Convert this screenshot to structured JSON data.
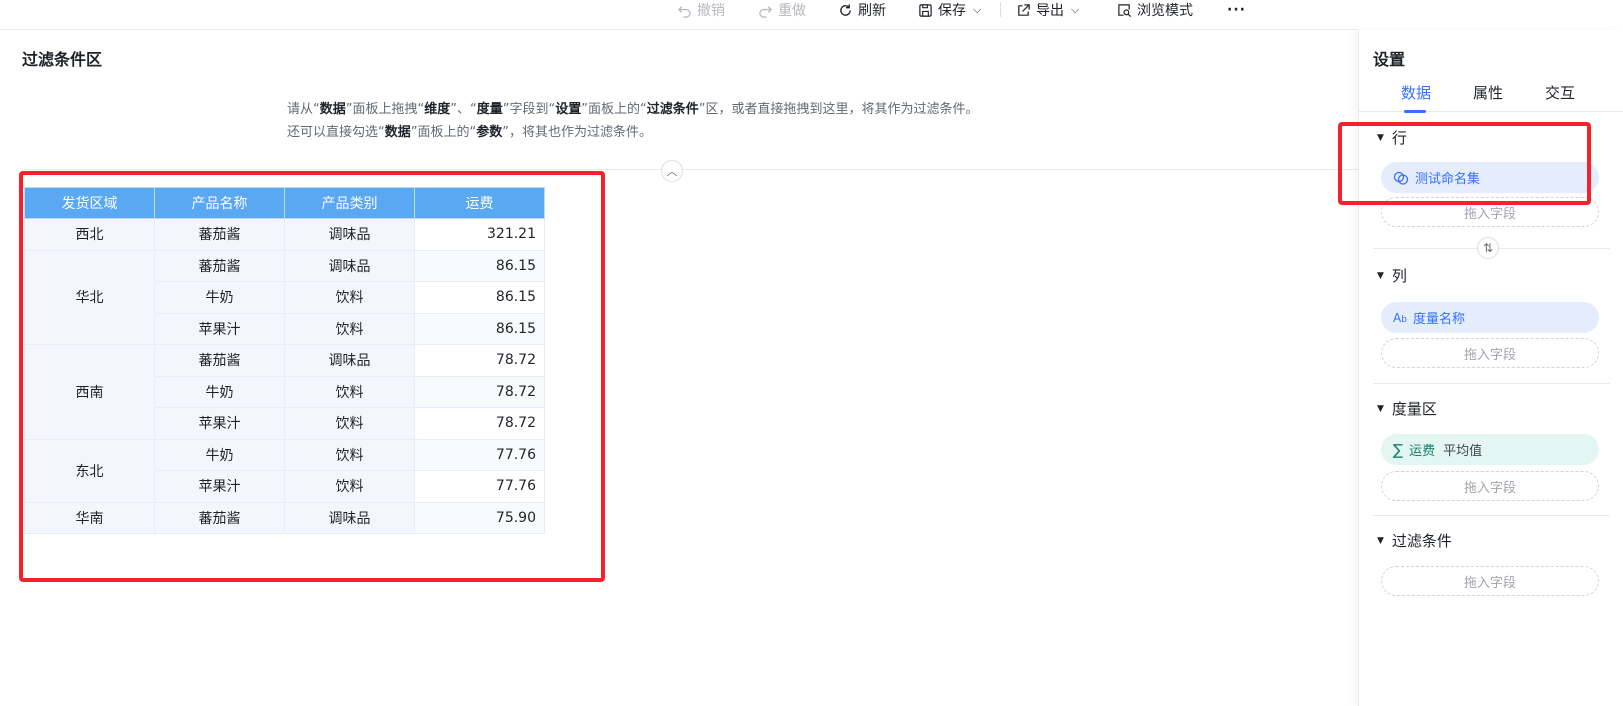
{
  "toolbar": {
    "undo": "撤销",
    "redo": "重做",
    "refresh": "刷新",
    "save": "保存",
    "export": "导出",
    "browse_mode": "浏览模式",
    "more": "···"
  },
  "filter_area": {
    "title": "过滤条件区",
    "hint1": {
      "p1": "请从“",
      "b1": "数据",
      "p2": "”面板上拖拽“",
      "b2": "维度",
      "p3": "”、“",
      "b3": "度量",
      "p4": "”字段到“",
      "b4": "设置",
      "p5": "”面板上的“",
      "b5": "过滤条件",
      "p6": "”区，或者直接拖拽到这里，将其作为过滤条件。"
    },
    "hint2": {
      "p1": "还可以直接勾选“",
      "b1": "数据",
      "p2": "”面板上的“",
      "b2": "参数",
      "p3": "”，将其也作为过滤条件。"
    },
    "collapse_icon": "chevron-up-icon"
  },
  "table": {
    "headers": [
      "发货区域",
      "产品名称",
      "产品类别",
      "运费"
    ],
    "groups": [
      {
        "region": "西北",
        "rows": [
          [
            "蕃茄酱",
            "调味品",
            "321.21"
          ]
        ]
      },
      {
        "region": "华北",
        "rows": [
          [
            "蕃茄酱",
            "调味品",
            "86.15"
          ],
          [
            "牛奶",
            "饮料",
            "86.15"
          ],
          [
            "苹果汁",
            "饮料",
            "86.15"
          ]
        ]
      },
      {
        "region": "西南",
        "rows": [
          [
            "蕃茄酱",
            "调味品",
            "78.72"
          ],
          [
            "牛奶",
            "饮料",
            "78.72"
          ],
          [
            "苹果汁",
            "饮料",
            "78.72"
          ]
        ]
      },
      {
        "region": "东北",
        "rows": [
          [
            "牛奶",
            "饮料",
            "77.76"
          ],
          [
            "苹果汁",
            "饮料",
            "77.76"
          ]
        ]
      },
      {
        "region": "华南",
        "rows": [
          [
            "蕃茄酱",
            "调味品",
            "75.90"
          ]
        ]
      }
    ]
  },
  "panel": {
    "title": "设置",
    "tabs": [
      "数据",
      "属性",
      "交互"
    ],
    "active_tab": "数据",
    "sections": {
      "row": {
        "label": "行",
        "field": "测试命名集",
        "drop": "拖入字段"
      },
      "column": {
        "label": "列",
        "field": "度量名称",
        "drop": "拖入字段"
      },
      "measure": {
        "label": "度量区",
        "field": "运费",
        "agg": "平均值",
        "drop": "拖入字段"
      },
      "filter": {
        "label": "过滤条件",
        "drop": "拖入字段"
      }
    }
  },
  "colors": {
    "accent": "#3370ff",
    "header_bg": "#5aa8f2",
    "highlight": "#f5222d"
  }
}
